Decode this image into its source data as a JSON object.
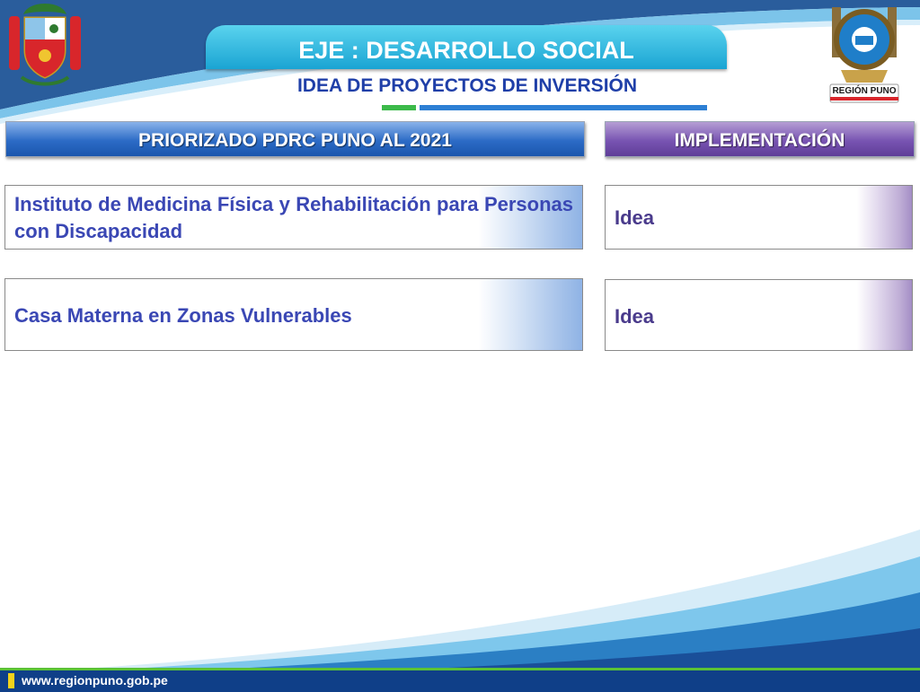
{
  "header": {
    "title": "EJE : DESARROLLO SOCIAL",
    "subtitle": "IDEA DE PROYECTOS DE INVERSIÓN"
  },
  "columns": {
    "priorizado": "PRIORIZADO  PDRC PUNO AL 2021",
    "implementacion": "IMPLEMENTACIÓN"
  },
  "rows": [
    {
      "project": "Instituto de Medicina Física y Rehabilitación para Personas con Discapacidad",
      "status": "Idea"
    },
    {
      "project": "Casa Materna en Zonas Vulnerables",
      "status": "Idea"
    }
  ],
  "logos": {
    "right_label": "REGIÓN PUNO"
  },
  "footer": {
    "url": "www.regionpuno.gob.pe"
  },
  "colors": {
    "title_blue": "#1aa4d3",
    "header_blue": "#2c6bc6",
    "header_purple": "#7854b2",
    "text_blue": "#3a47b4",
    "footer_navy": "#0f3f88"
  }
}
